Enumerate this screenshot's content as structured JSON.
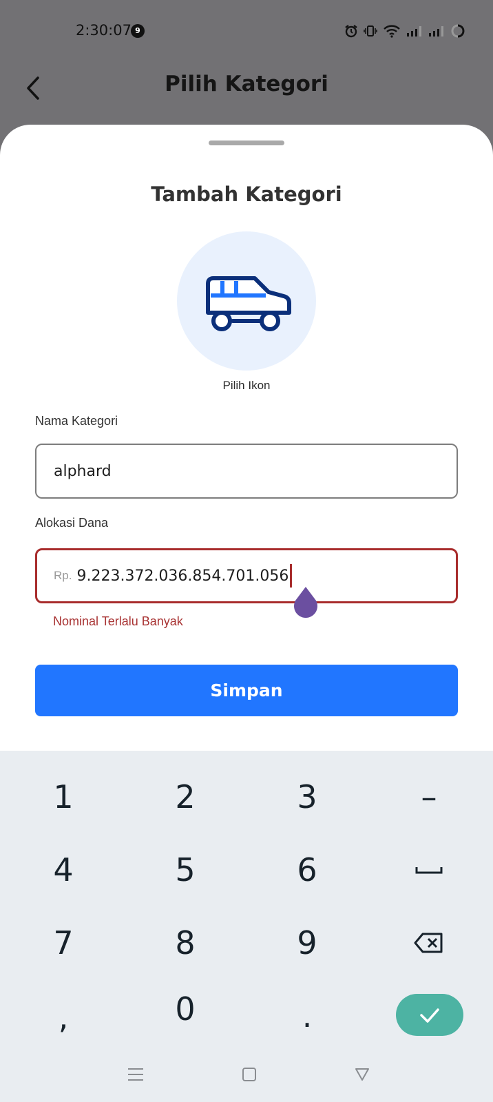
{
  "status_bar": {
    "time": "2:30:07",
    "notification_count": "9",
    "icons": [
      "alarm-icon",
      "vibrate-icon",
      "wifi-icon",
      "signal-icon",
      "signal-icon",
      "battery-icon"
    ]
  },
  "header": {
    "title": "Pilih Kategori",
    "back_icon": "chevron-left-icon"
  },
  "sheet": {
    "title": "Tambah Kategori",
    "icon_picker": {
      "icon": "car-icon",
      "label": "Pilih Ikon"
    },
    "category_name": {
      "label": "Nama Kategori",
      "value": "alphard"
    },
    "allocation": {
      "label": "Alokasi Dana",
      "prefix": "Rp.",
      "value": "9.223.372.036.854.701.056",
      "error": "Nominal Terlalu Banyak"
    },
    "save_label": "Simpan"
  },
  "keyboard": {
    "rows": [
      [
        "1",
        "2",
        "3",
        "–"
      ],
      [
        "4",
        "5",
        "6",
        "␣"
      ],
      [
        "7",
        "8",
        "9",
        "⌫"
      ],
      [
        ",",
        "0",
        ".",
        "✓"
      ]
    ]
  },
  "nav_bar": {
    "buttons": [
      "menu-icon",
      "home-icon",
      "back-triangle-icon"
    ]
  },
  "colors": {
    "primary": "#2176ff",
    "error": "#a82c2c",
    "icon_bg": "#e9f1fd",
    "icon_stroke": "#0b2f7a",
    "enter_key": "#4db3a3",
    "cursor_handle": "#6b4fa0"
  }
}
